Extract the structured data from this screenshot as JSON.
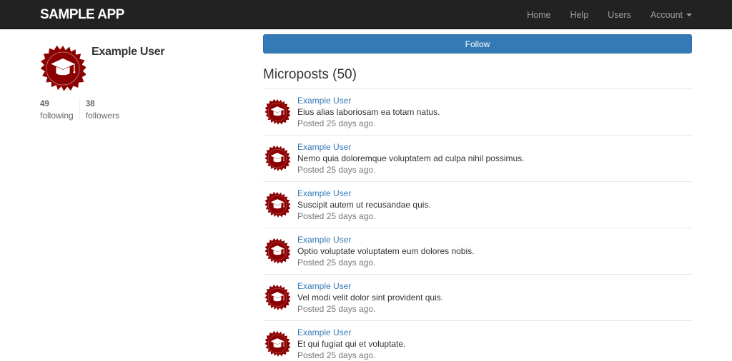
{
  "header": {
    "brand": "SAMPLE APP",
    "nav": {
      "home": "Home",
      "help": "Help",
      "users": "Users",
      "account": "Account"
    }
  },
  "profile": {
    "name": "Example User",
    "avatar_icon": "graduation-cap-badge-icon",
    "stats": {
      "following_count": "49",
      "following_label": "following",
      "followers_count": "38",
      "followers_label": "followers"
    }
  },
  "main": {
    "follow_label": "Follow",
    "microposts_title": "Microposts (50)",
    "posts": [
      {
        "user": "Example User",
        "content": "Eius alias laboriosam ea totam natus.",
        "time": "Posted 25 days ago."
      },
      {
        "user": "Example User",
        "content": "Nemo quia doloremque voluptatem ad culpa nihil possimus.",
        "time": "Posted 25 days ago."
      },
      {
        "user": "Example User",
        "content": "Suscipit autem ut recusandae quis.",
        "time": "Posted 25 days ago."
      },
      {
        "user": "Example User",
        "content": "Optio voluptate voluptatem eum dolores nobis.",
        "time": "Posted 25 days ago."
      },
      {
        "user": "Example User",
        "content": "Vel modi velit dolor sint provident quis.",
        "time": "Posted 25 days ago."
      },
      {
        "user": "Example User",
        "content": "Et qui fugiat qui et voluptate.",
        "time": "Posted 25 days ago."
      }
    ]
  },
  "colors": {
    "navbar": "#222222",
    "link": "#337ab7",
    "button": "#337ab7",
    "badge": "#8b0000"
  }
}
